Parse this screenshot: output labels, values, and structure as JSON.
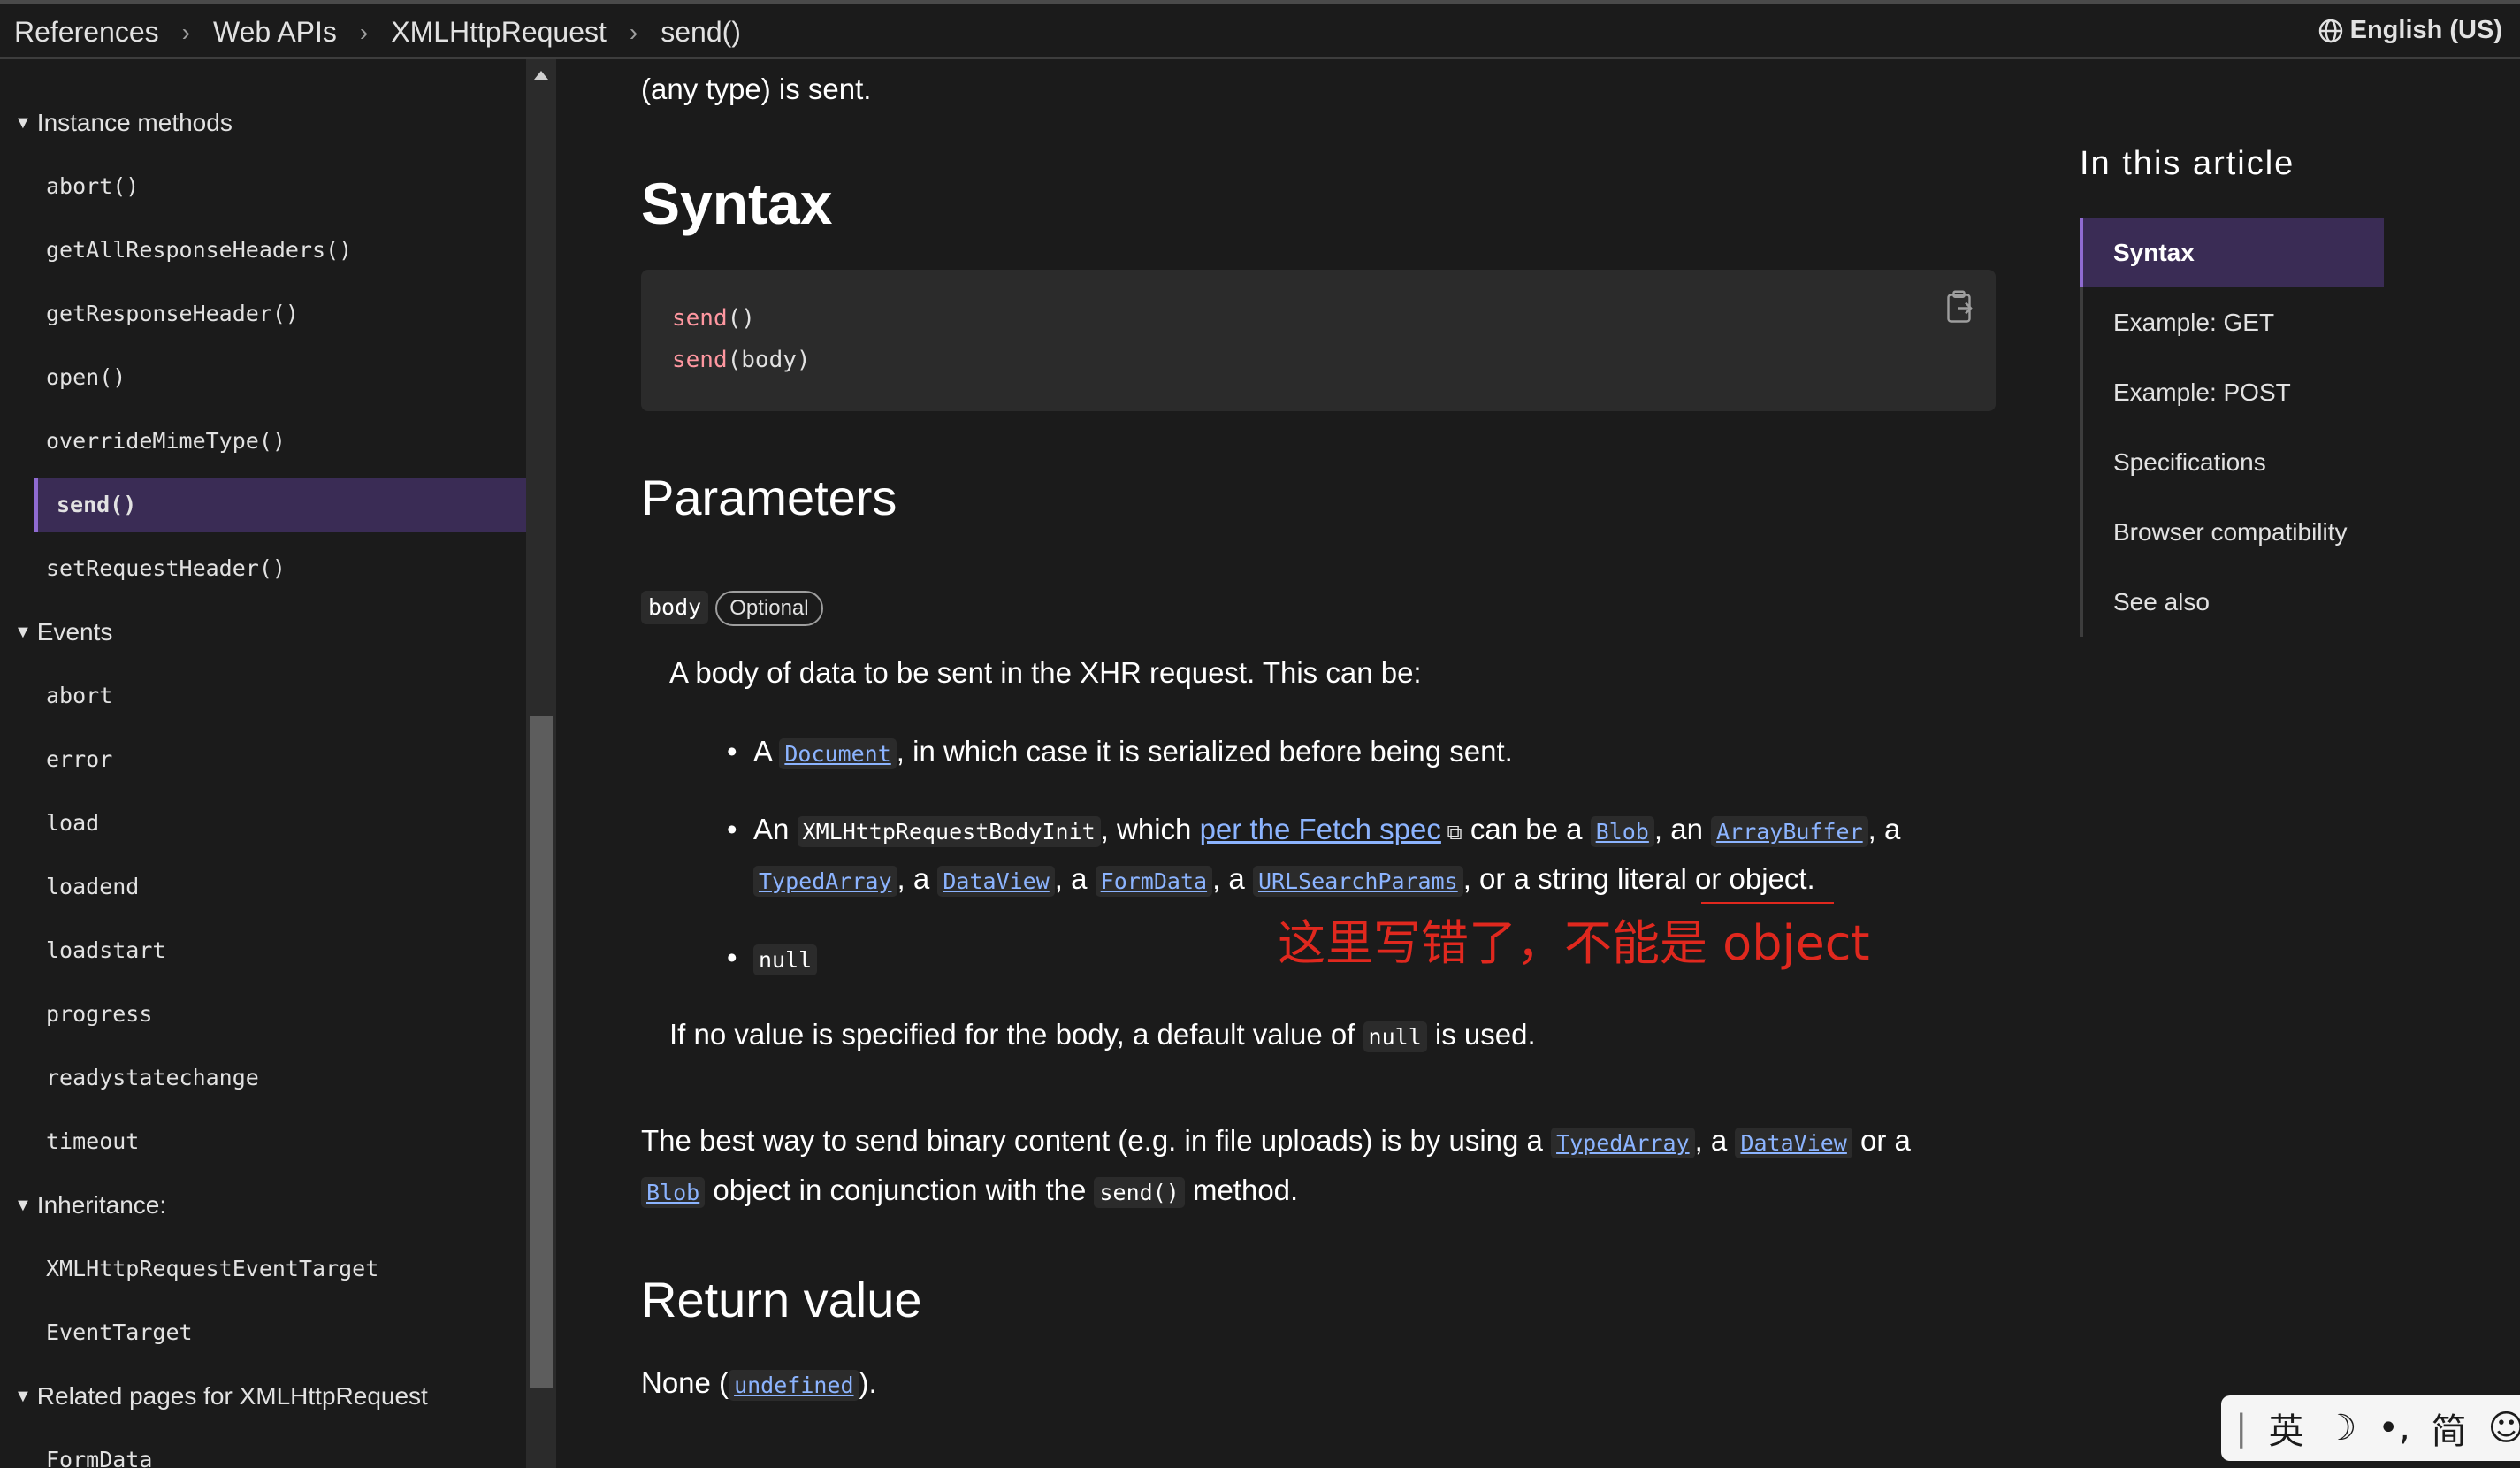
{
  "breadcrumbs": [
    "References",
    "Web APIs",
    "XMLHttpRequest",
    "send()"
  ],
  "language": "English (US)",
  "sidebar": {
    "groups": [
      {
        "title": "Instance methods",
        "items": [
          "abort()",
          "getAllResponseHeaders()",
          "getResponseHeader()",
          "open()",
          "overrideMimeType()",
          "send()",
          "setRequestHeader()"
        ],
        "active": "send()"
      },
      {
        "title": "Events",
        "items": [
          "abort",
          "error",
          "load",
          "loadend",
          "loadstart",
          "progress",
          "readystatechange",
          "timeout"
        ]
      },
      {
        "title": "Inheritance:",
        "items": [
          "XMLHttpRequestEventTarget",
          "EventTarget"
        ]
      },
      {
        "title": "Related pages for XMLHttpRequest",
        "items": [
          "FormData"
        ]
      }
    ]
  },
  "main": {
    "intro_tail": "(any type) is sent.",
    "syntax_heading": "Syntax",
    "code_lines": [
      {
        "fn": "send",
        "args": "()"
      },
      {
        "fn": "send",
        "args": "(body)"
      }
    ],
    "parameters_heading": "Parameters",
    "param_name": "body",
    "param_badge": "Optional",
    "param_desc": "A body of data to be sent in the XHR request. This can be:",
    "bullet1": {
      "pre": "A ",
      "link": "Document",
      "post": ", in which case it is serialized before being sent."
    },
    "bullet2": {
      "t1": "An ",
      "code1": "XMLHttpRequestBodyInit",
      "t2": ", which ",
      "spec_link": "per the Fetch spec",
      "t3": " can be a ",
      "blob": "Blob",
      "t4": ", an ",
      "arraybuffer": "ArrayBuffer",
      "t5": ", a",
      "typedarray": "TypedArray",
      "t6": ", a ",
      "dataview": "DataView",
      "t7": ", a ",
      "formdata": "FormData",
      "t8": ", a ",
      "urlsearchparams": "URLSearchParams",
      "t9": ", or a string literal or object."
    },
    "bullet3": "null",
    "annotation": "这里写错了，不能是 object",
    "default_note": {
      "pre": "If no value is specified for the body, a default value of ",
      "code": "null",
      "post": " is used."
    },
    "binary": {
      "pre": "The best way to send binary content (e.g. in file uploads) is by using a ",
      "l1": "TypedArray",
      "m1": ", a ",
      "l2": "DataView",
      "m2": " or a",
      "l3": "Blob",
      "m3": " object in conjunction with the ",
      "code": "send()",
      "post": " method."
    },
    "return_heading": "Return value",
    "return_value": {
      "pre": "None (",
      "link": "undefined",
      "post": ")."
    }
  },
  "toc": {
    "title": "In this article",
    "items": [
      "Syntax",
      "Example: GET",
      "Example: POST",
      "Specifications",
      "Browser compatibility",
      "See also"
    ],
    "active": "Syntax"
  },
  "ime": {
    "mode": "英",
    "moon": "☽",
    "punct": "•,",
    "script": "简"
  },
  "colors": {
    "accent": "#8f6bd1",
    "link": "#8cb4ff",
    "annotation": "#e0281e",
    "bg": "#1b1b1b"
  }
}
